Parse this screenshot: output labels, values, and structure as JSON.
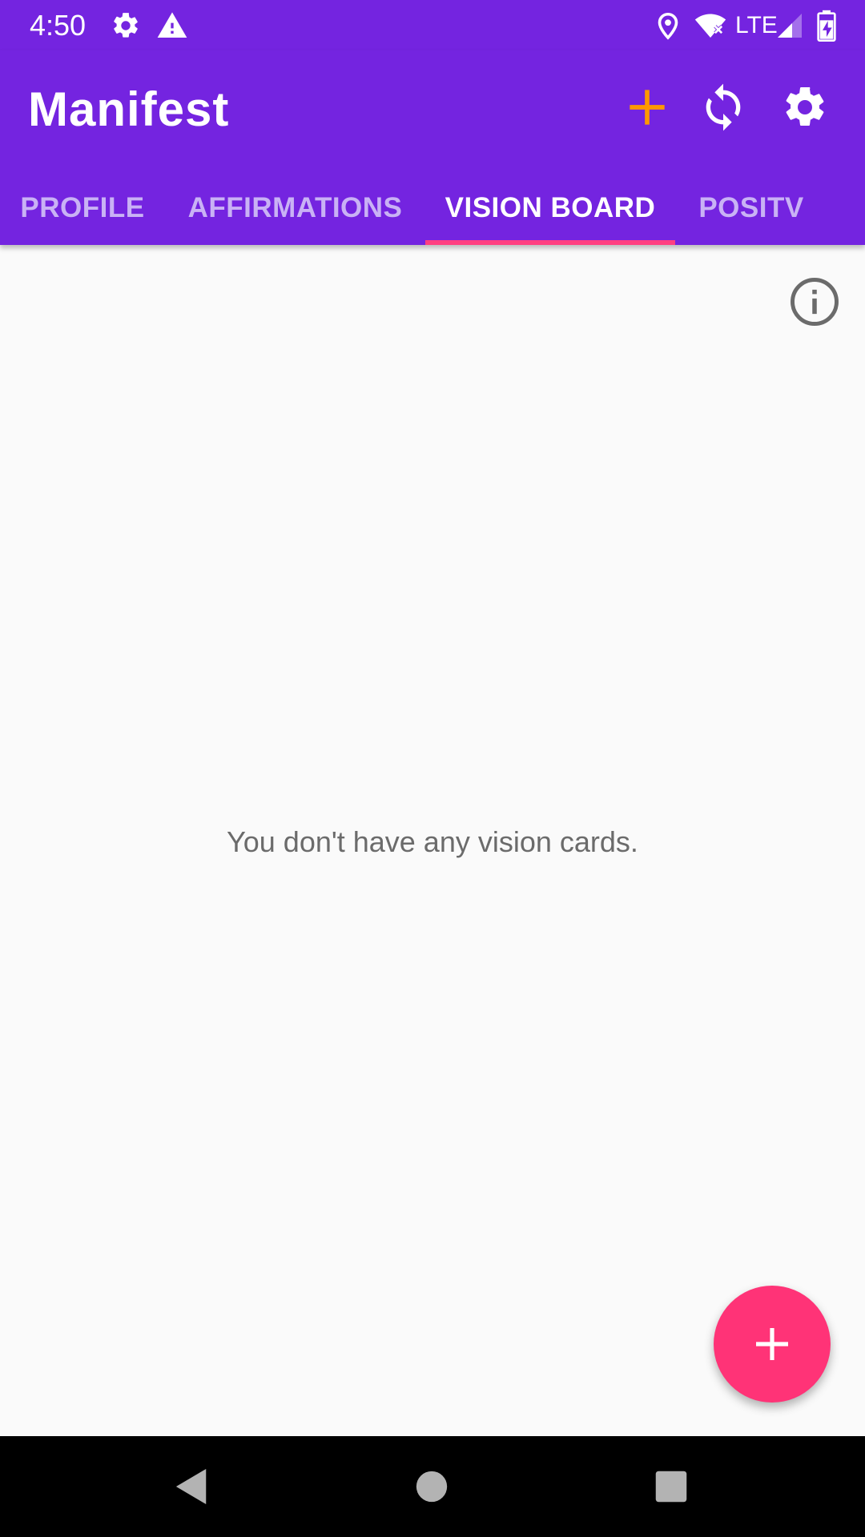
{
  "status_bar": {
    "time": "4:50",
    "network": "LTE",
    "icons": [
      "settings-icon",
      "warning-icon",
      "location-icon",
      "wifi-icon",
      "signal-icon",
      "battery-charging-icon"
    ]
  },
  "app_bar": {
    "title": "Manifest",
    "actions": [
      {
        "name": "add",
        "icon": "plus-icon",
        "color": "#ff9800"
      },
      {
        "name": "sync",
        "icon": "sync-icon",
        "color": "#ffffff"
      },
      {
        "name": "settings",
        "icon": "gear-icon",
        "color": "#ffffff"
      }
    ]
  },
  "tabs": [
    {
      "label": "PROFILE",
      "active": false
    },
    {
      "label": "AFFIRMATIONS",
      "active": false
    },
    {
      "label": "VISION BOARD",
      "active": true
    },
    {
      "label": "POSITV",
      "active": false
    }
  ],
  "content": {
    "empty_message": "You don't have any vision cards.",
    "info_icon": "info-icon"
  },
  "fab": {
    "icon": "plus-icon"
  },
  "nav_bar": {
    "buttons": [
      "back-icon",
      "home-icon",
      "recents-icon"
    ]
  },
  "colors": {
    "primary": "#7424e0",
    "accent": "#ff4081",
    "fab": "#ff3377",
    "add_action": "#ff9800",
    "tab_inactive": "#c9b2f5",
    "background": "#fafafa",
    "empty_text": "#6b6b6b"
  }
}
